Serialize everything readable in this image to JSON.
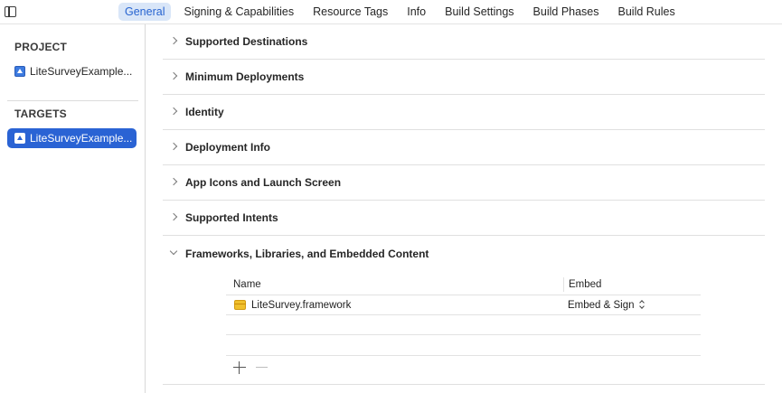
{
  "tabs": [
    {
      "label": "General",
      "active": true
    },
    {
      "label": "Signing & Capabilities",
      "active": false
    },
    {
      "label": "Resource Tags",
      "active": false
    },
    {
      "label": "Info",
      "active": false
    },
    {
      "label": "Build Settings",
      "active": false
    },
    {
      "label": "Build Phases",
      "active": false
    },
    {
      "label": "Build Rules",
      "active": false
    }
  ],
  "sidebar": {
    "project_heading": "PROJECT",
    "project_item": "LiteSurveyExample...",
    "targets_heading": "TARGETS",
    "target_item": "LiteSurveyExample..."
  },
  "sections": [
    {
      "title": "Supported Destinations",
      "expanded": false
    },
    {
      "title": "Minimum Deployments",
      "expanded": false
    },
    {
      "title": "Identity",
      "expanded": false
    },
    {
      "title": "Deployment Info",
      "expanded": false
    },
    {
      "title": "App Icons and Launch Screen",
      "expanded": false
    },
    {
      "title": "Supported Intents",
      "expanded": false
    },
    {
      "title": "Frameworks, Libraries, and Embedded Content",
      "expanded": true
    }
  ],
  "frameworks": {
    "columns": {
      "name": "Name",
      "embed": "Embed"
    },
    "rows": [
      {
        "name": "LiteSurvey.framework",
        "embed": "Embed & Sign"
      }
    ]
  },
  "colors": {
    "accent": "#2a63d4",
    "active_tab_bg": "#d9e6f8",
    "active_tab_text": "#2764d0"
  },
  "icons": {
    "sidebar_toggle": "sidebar-toggle-icon",
    "app_target": "app-icon",
    "framework": "framework-box-icon",
    "disclosure": "chevron-right-icon",
    "add": "plus-icon",
    "remove": "minus-icon"
  }
}
